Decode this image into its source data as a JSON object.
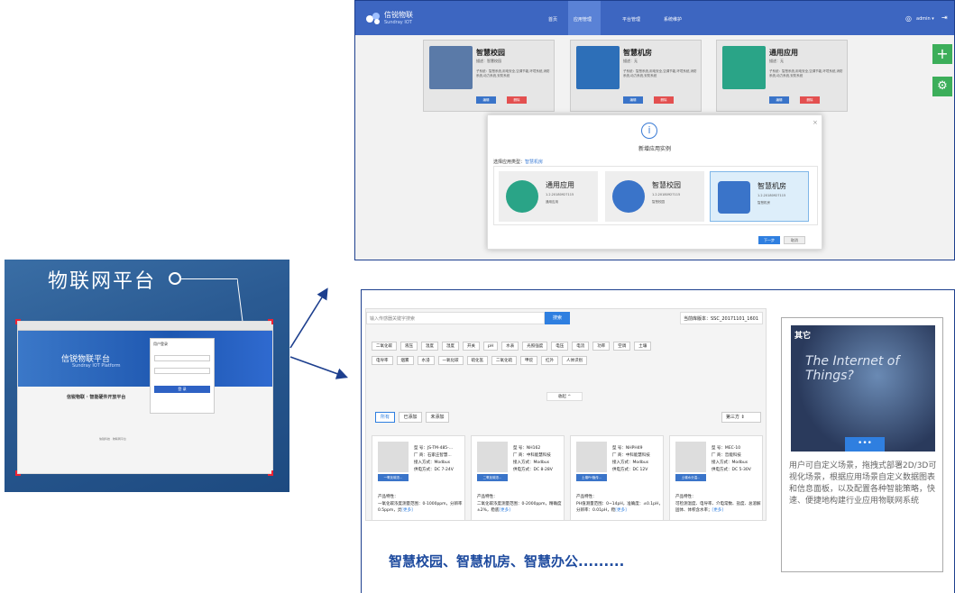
{
  "left_panel": {
    "title": "物联网平台",
    "brand": "信锐物联平台",
    "brand_sub": "Sundray IOT Platform",
    "login_title": "用户登录",
    "login_button": "登 录",
    "platform_name": "信锐物联 · 智能硬件开放平台",
    "footer": "信锐科技 · 物联网平台"
  },
  "top_screen": {
    "logo": "信锐物联",
    "logo_sub": "Sundray IOT",
    "nav": [
      "首页",
      "应用管理",
      "平台管理",
      "系统维护"
    ],
    "user": "admin ▾",
    "cards": [
      {
        "title": "智慧校园",
        "sub": "描述：智慧校园",
        "desc": "子系统：智慧系统,用电安全,空调节能,环境系统,消防系统,动力系统,安防系统",
        "edit": "编辑",
        "del": "删除",
        "color": "#5a7aa8"
      },
      {
        "title": "智慧机房",
        "sub": "描述：无",
        "desc": "子系统：智慧系统,用电安全,空调节能,环境系统,消防系统,动力系统,安防系统",
        "edit": "编辑",
        "del": "删除",
        "color": "#2d6fb8"
      },
      {
        "title": "通用应用",
        "sub": "描述：无",
        "desc": "子系统：智慧系统,用电安全,空调节能,环境系统,消防系统,动力系统,安防系统",
        "edit": "编辑",
        "del": "删除",
        "color": "#2aa487"
      }
    ],
    "modal": {
      "icon": "i",
      "title": "新增应用实例",
      "select_label": "选择应用类型：",
      "select_value": "智慧机房",
      "close": "×",
      "options": [
        {
          "title": "通用应用",
          "num": "1.2.20180927115",
          "desc": "通用应用",
          "color": "#2aa487"
        },
        {
          "title": "智慧校园",
          "num": "1.2.20180927115",
          "desc": "智慧校园",
          "color": "#3a74c9"
        },
        {
          "title": "智慧机房",
          "num": "1.2.20180927115",
          "desc": "智慧机房",
          "color": "#3a74c9"
        }
      ],
      "next": "下一步",
      "cancel": "取消"
    }
  },
  "store": {
    "search_placeholder": "输入传感器关键字搜索",
    "search_btn": "搜索",
    "version": "当前库版本：SSC_20171101_1601",
    "tags_row1": [
      "二氧化碳",
      "液压",
      "温度",
      "湿度",
      "开关",
      "pH",
      "水表",
      "光照强度",
      "电压",
      "电流",
      "功率",
      "空调",
      "土壤"
    ],
    "tags_row2": [
      "电导率",
      "烟雾",
      "水浸",
      "一氧化碳",
      "硫化氢",
      "二氧化硫",
      "甲烷",
      "红外",
      "人体识别"
    ],
    "fold": "收起 ^",
    "filters": [
      "所有",
      "已添加",
      "未添加"
    ],
    "third": "第三方",
    "products": [
      {
        "label": "一氧化碳浓...",
        "model": "型    号：JS-TM-485-...",
        "vendor": "厂    商：石家庄智慧...",
        "access": "接入方式：Modbus",
        "power": "供电方式：DC 7-24V",
        "feature": "产品特性：",
        "desc": "一氧化碳浓度测量范围：0-1000ppm，分辨率0.5ppm，灵",
        "more": "[更多]",
        "add": "已添加"
      },
      {
        "label": "二氧化碳浓...",
        "model": "型    号：NH162",
        "vendor": "厂    商：中科能慧科技",
        "access": "接入方式：Modbus",
        "power": "供电方式：DC 8-28V",
        "feature": "产品特性：",
        "desc": "二氧化碳浓度测量范围：0-2000ppm，精确度±2%，稳底",
        "more": "[更多]",
        "add": "已添加"
      },
      {
        "label": "土壤PH值传...",
        "model": "型    号：NHPH49",
        "vendor": "厂    商：中科能慧科技",
        "access": "接入方式：Modbus",
        "power": "供电方式：DC 12V",
        "feature": "产品特性：",
        "desc": "PH值测量范围：0~14pH，准确度：±0.1pH，分辨率：0.01pH，稳",
        "more": "[更多]",
        "add": "已添加"
      },
      {
        "label": "土壤水分温...",
        "model": "型    号：MEC-10",
        "vendor": "厂    商：哲能科技",
        "access": "接入方式：Modbus",
        "power": "供电方式：DC 5-30V",
        "feature": "产品特性：",
        "desc": "可检测温度、电导率、介电常数、盐度、总溶解固体、体积含水率；",
        "more": "[更多]",
        "add": "已添加"
      }
    ]
  },
  "slogan": "智慧校园、智慧机房、智慧办公.........",
  "side": {
    "title": "其它",
    "img_text": "The Internet of Things?",
    "dots": "•••",
    "desc": "用户可自定义场景，拖拽式部署2D/3D可视化场景，根据应用场景自定义数据图表和信息面板，以及配置各种智能策略，快速、便捷地构建行业应用物联网系统"
  }
}
